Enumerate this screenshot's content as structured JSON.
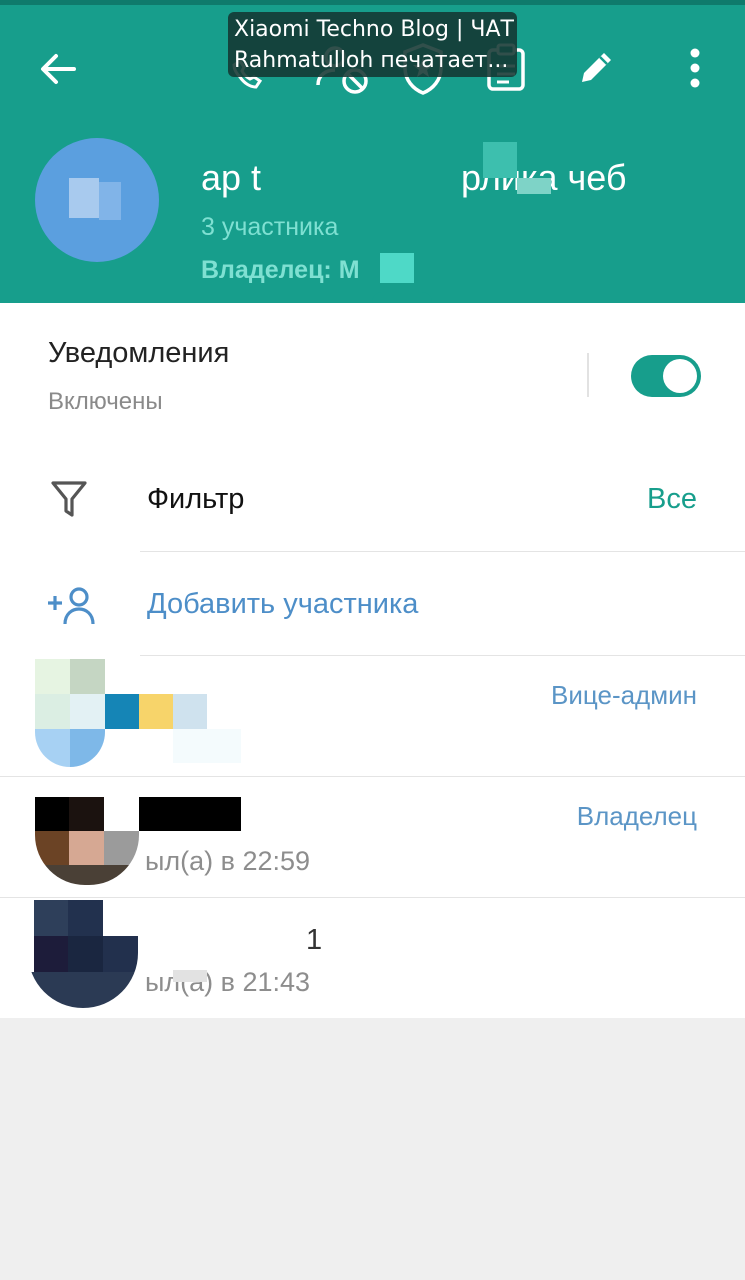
{
  "toast": {
    "line1": "Xiaomi Techno Blog | ЧАТ",
    "line2": "Rahmatulloh печатает..."
  },
  "header": {
    "title_start": "ap t",
    "title_end": "рлика чеб",
    "members": "3 участника",
    "owner": "Владелец: М"
  },
  "icons": {
    "back": "arrow-left-icon",
    "edit": "pencil-icon",
    "more": "kebab-menu-icon"
  },
  "notifications": {
    "title": "Уведомления",
    "status": "Включены",
    "enabled": true
  },
  "filter": {
    "label": "Фильтр",
    "value": "Все"
  },
  "add_member": {
    "label": "Добавить участника"
  },
  "members": [
    {
      "role": "Вице-админ",
      "status": ""
    },
    {
      "role": "Владелец",
      "status": "ыл(а) в 22:59"
    },
    {
      "role": "",
      "status": "ыл(а) в 21:43",
      "name_suffix": "1"
    }
  ],
  "colors": {
    "primary": "#179e8c",
    "link": "#4d8ec8",
    "role": "#5b95c6"
  }
}
